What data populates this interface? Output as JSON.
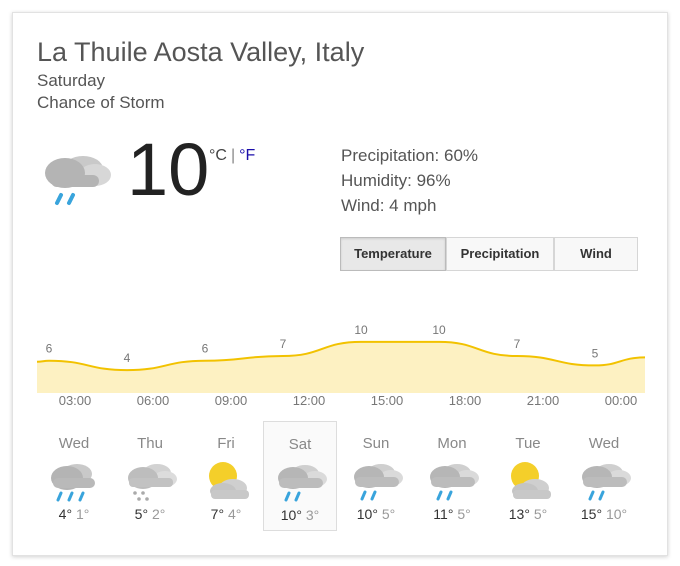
{
  "location": "La Thuile Aosta Valley, Italy",
  "day": "Saturday",
  "condition": "Chance of Storm",
  "current": {
    "temperature": "10",
    "unit_c": "°C",
    "unit_sep": "|",
    "unit_f": "°F",
    "icon": "storm-cloud-icon"
  },
  "details": {
    "precipitation": "Precipitation: 60%",
    "humidity": "Humidity: 96%",
    "wind": "Wind: 4 mph"
  },
  "tabs": [
    {
      "label": "Temperature",
      "active": true
    },
    {
      "label": "Precipitation",
      "active": false
    },
    {
      "label": "Wind",
      "active": false
    }
  ],
  "chart_data": {
    "type": "area",
    "x": [
      "03:00",
      "06:00",
      "09:00",
      "12:00",
      "15:00",
      "18:00",
      "21:00",
      "00:00"
    ],
    "values": [
      6,
      4,
      6,
      7,
      10,
      10,
      7,
      5
    ],
    "ylim": [
      0,
      14
    ],
    "fill_color": "#fdf1c2",
    "line_color": "#f2c200"
  },
  "forecast": [
    {
      "day": "Wed",
      "high": "4°",
      "low": "1°",
      "icon": "rain-cloud-icon"
    },
    {
      "day": "Thu",
      "high": "5°",
      "low": "2°",
      "icon": "snow-cloud-icon"
    },
    {
      "day": "Fri",
      "high": "7°",
      "low": "4°",
      "icon": "partly-sunny-icon"
    },
    {
      "day": "Sat",
      "high": "10°",
      "low": "3°",
      "icon": "storm-cloud-icon",
      "selected": true
    },
    {
      "day": "Sun",
      "high": "10°",
      "low": "5°",
      "icon": "storm-cloud-icon"
    },
    {
      "day": "Mon",
      "high": "11°",
      "low": "5°",
      "icon": "storm-cloud-icon"
    },
    {
      "day": "Tue",
      "high": "13°",
      "low": "5°",
      "icon": "partly-sunny-icon"
    },
    {
      "day": "Wed",
      "high": "15°",
      "low": "10°",
      "icon": "storm-cloud-icon"
    }
  ]
}
